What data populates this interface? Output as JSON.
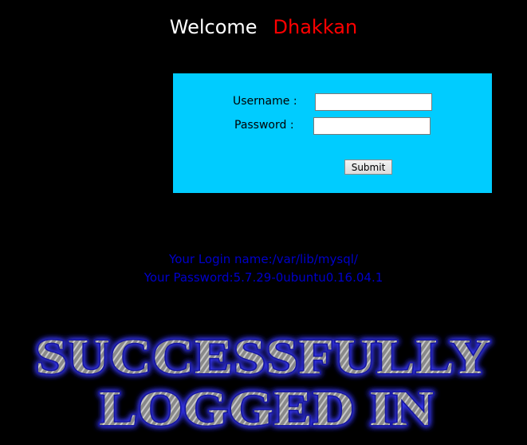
{
  "header": {
    "welcome_label": "Welcome",
    "name": "Dhakkan"
  },
  "login_form": {
    "username_label": "Username :",
    "username_value": "",
    "password_label": "Password :",
    "password_value": "",
    "submit_label": "Submit"
  },
  "result": {
    "login_line": "Your Login name:/var/lib/mysql/",
    "password_line": "Your Password:5.7.29-0ubuntu0.16.04.1"
  },
  "banner": {
    "line1": "SUCCESSFULLY",
    "line2": "LOGGED IN"
  },
  "colors": {
    "background": "#000000",
    "panel": "#00ccff",
    "name": "#ff0000",
    "result_text": "#0000cc",
    "banner_glow": "#2a2aff"
  }
}
